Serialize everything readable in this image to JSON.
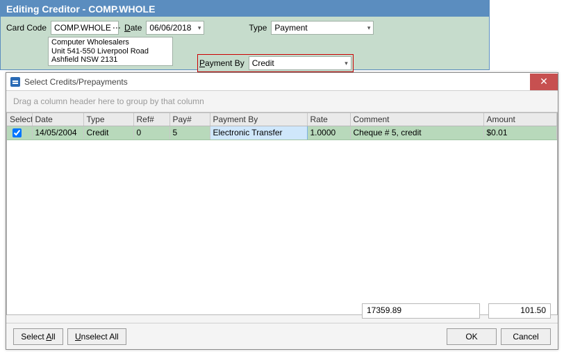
{
  "outer": {
    "title": "Editing Creditor - COMP.WHOLE",
    "card_code_label": "Card Code",
    "card_code": "COMP.WHOLE",
    "date_label": "Date",
    "date": "06/06/2018",
    "type_label": "Type",
    "type": "Payment",
    "address": {
      "line1": "Computer Wholesalers",
      "line2": "Unit 541-550 Liverpool Road",
      "line3": "Ashfield NSW 2131"
    },
    "payment_by_label": "Payment By",
    "payment_by": "Credit"
  },
  "dialog": {
    "title": "Select Credits/Prepayments",
    "group_hint": "Drag a column header here to group by that column",
    "columns": {
      "select": "Select",
      "date": "Date",
      "type": "Type",
      "ref": "Ref#",
      "pay": "Pay#",
      "payment_by": "Payment By",
      "rate": "Rate",
      "comment": "Comment",
      "amount": "Amount"
    },
    "rows": [
      {
        "selected": true,
        "date": "14/05/2004",
        "type": "Credit",
        "ref": "0",
        "pay": "5",
        "payment_by": "Electronic Transfer",
        "rate": "1.0000",
        "comment": "Cheque # 5, credit",
        "amount": "$0.01"
      }
    ],
    "totals": {
      "t1": "17359.89",
      "t2": "101.50"
    },
    "buttons": {
      "select_all": "Select All",
      "unselect_all": "Unselect All",
      "ok": "OK",
      "cancel": "Cancel"
    }
  }
}
